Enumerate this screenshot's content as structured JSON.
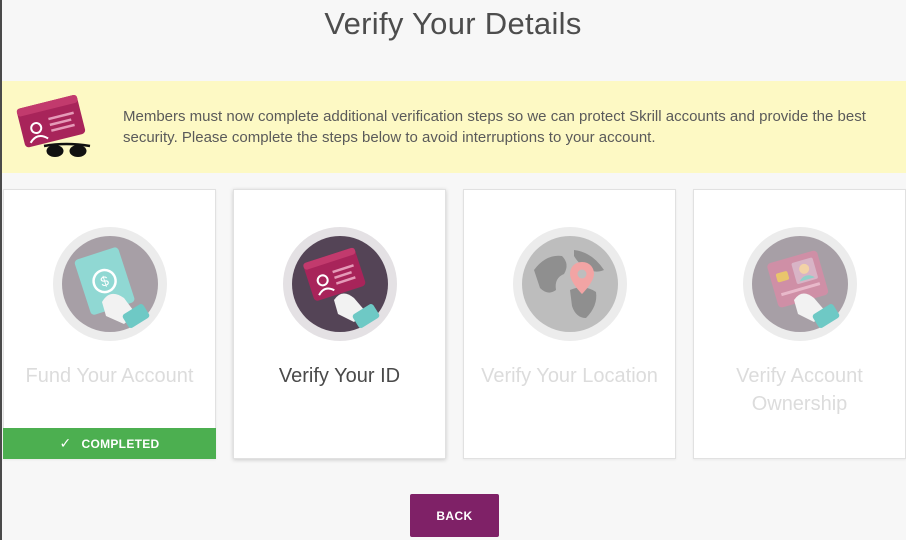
{
  "page": {
    "title": "Verify Your Details"
  },
  "notice": {
    "text": "Members must now complete additional verification steps so we can protect Skrill accounts and provide the best security. Please complete the steps below to avoid interruptions to your account.",
    "illustration_icon": "id-card-with-sunglasses-icon",
    "card_tag": "ID CARD"
  },
  "steps": [
    {
      "label": "Fund Your Account",
      "icon": "money-hand-icon",
      "status": "completed",
      "status_label": "COMPLETED",
      "status_icon": "checkmark-icon"
    },
    {
      "label": "Verify Your ID",
      "icon": "id-card-hand-icon",
      "status": "active"
    },
    {
      "label": "Verify Your Location",
      "icon": "globe-location-pin-icon",
      "status": "inactive"
    },
    {
      "label": "Verify Account Ownership",
      "icon": "photo-card-hand-icon",
      "status": "inactive"
    }
  ],
  "actions": {
    "back_label": "BACK"
  },
  "colors": {
    "brand": "#7f2167",
    "completed": "#4caf50",
    "notice_bg": "#fdf9c4",
    "card_magenta": "#a8245a",
    "sleeve": "#6ec9c5"
  }
}
